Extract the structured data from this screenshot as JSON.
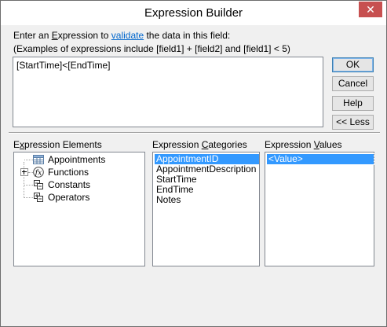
{
  "window": {
    "title": "Expression Builder",
    "close_glyph": "✕"
  },
  "instructions": {
    "line1_pre": "Enter an ",
    "line1_expr_u": "E",
    "line1_expr_rest": "xpression to ",
    "line1_link": "validate",
    "line1_post": " the data in this field:",
    "line2": "(Examples of expressions include [field1] + [field2] and [field1] < 5)"
  },
  "expression": {
    "value": "[StartTime]<[EndTime]"
  },
  "buttons": {
    "ok": "OK",
    "cancel": "Cancel",
    "help": "Help",
    "less": "<< Less"
  },
  "elements": {
    "label_u": "x",
    "label_pre": "E",
    "label_post": "pression Elements",
    "items": [
      {
        "label": "Appointments",
        "icon": "table-icon",
        "expandable": false
      },
      {
        "label": "Functions",
        "icon": "function-icon",
        "expandable": true
      },
      {
        "label": "Constants",
        "icon": "constants-icon",
        "expandable": false
      },
      {
        "label": "Operators",
        "icon": "operators-icon",
        "expandable": false
      }
    ]
  },
  "categories": {
    "label_pre": "Expression ",
    "label_u": "C",
    "label_post": "ategories",
    "items": [
      "AppointmentID",
      "AppointmentDescription",
      "StartTime",
      "EndTime",
      "Notes"
    ],
    "selected_index": 0
  },
  "values": {
    "label_pre": "Expression ",
    "label_u": "V",
    "label_post": "alues",
    "items": [
      "<Value>"
    ],
    "selected_index": 0
  },
  "colors": {
    "selection": "#3399ff",
    "link": "#0066cc",
    "close": "#c75050"
  }
}
